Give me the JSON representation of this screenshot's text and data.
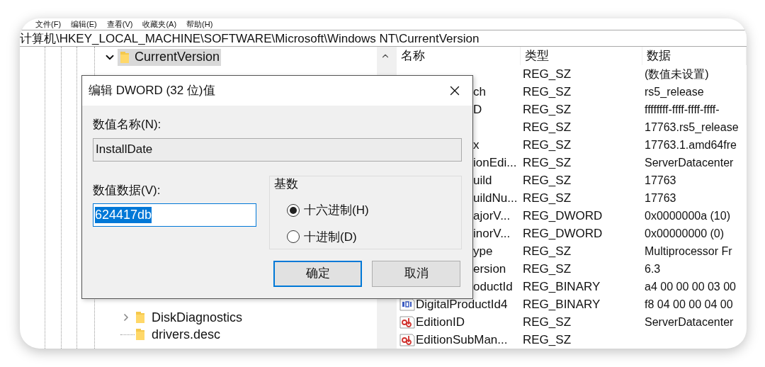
{
  "menu_bar": [
    "文件(F)",
    "编辑(E)",
    "查看(V)",
    "收藏夹(A)",
    "帮助(H)"
  ],
  "address_bar": "计算机\\HKEY_LOCAL_MACHINE\\SOFTWARE\\Microsoft\\Windows NT\\CurrentVersion",
  "tree": [
    {
      "label": "CurrentVersion",
      "expanded": true,
      "selected": true,
      "children": [
        {
          "label": "DiskDiagnostics",
          "kind": "folder"
        },
        {
          "label": "drivers.desc",
          "kind": "leaf"
        }
      ]
    }
  ],
  "list": {
    "columns": [
      "名称",
      "类型",
      "数据"
    ],
    "rows": [
      {
        "type": "REG_SZ",
        "data": "(数值未设置)"
      },
      {
        "name": "ch",
        "type": "REG_SZ",
        "data": "rs5_release",
        "partial": true
      },
      {
        "name": "D",
        "type": "REG_SZ",
        "data": "ffffffff-ffff-ffff-ffff-",
        "partial": true
      },
      {
        "type": "REG_SZ",
        "data": "17763.rs5_release"
      },
      {
        "name": "x",
        "type": "REG_SZ",
        "data": "17763.1.amd64fre",
        "partial": true
      },
      {
        "name": "ionEdi...",
        "type": "REG_SZ",
        "data": "ServerDatacenter",
        "partial": true
      },
      {
        "name": "uild",
        "type": "REG_SZ",
        "data": "17763",
        "partial": true
      },
      {
        "name": "uildNu...",
        "type": "REG_SZ",
        "data": "17763",
        "partial": true
      },
      {
        "name": "ajorV...",
        "type": "REG_DWORD",
        "data": "0x0000000a (10)",
        "partial": true
      },
      {
        "name": "inorV...",
        "type": "REG_DWORD",
        "data": "0x00000000 (0)",
        "partial": true
      },
      {
        "name": "ype",
        "type": "REG_SZ",
        "data": "Multiprocessor Fr",
        "partial": true
      },
      {
        "name": "ersion",
        "type": "REG_SZ",
        "data": "6.3",
        "partial": true
      },
      {
        "name": "oductId",
        "type": "REG_BINARY",
        "data": "a4 00 00 00 03 00",
        "partial": true
      },
      {
        "name": "DigitalProductId4",
        "type": "REG_BINARY",
        "data": "f8 04 00 00 04 00",
        "partial": false,
        "kind": "binary"
      },
      {
        "name": "EditionID",
        "type": "REG_SZ",
        "data": "ServerDatacenter",
        "partial": false,
        "kind": "string"
      },
      {
        "name": "EditionSubMan...",
        "type": "REG_SZ",
        "partial": false,
        "kind": "string"
      }
    ]
  },
  "dialog": {
    "title": "编辑 DWORD (32 位)值",
    "name_label": "数值名称(N):",
    "name_value": "InstallDate",
    "data_label": "数值数据(V):",
    "data_value": "624417db",
    "base": {
      "title": "基数",
      "options": [
        {
          "label": "十六进制(H)",
          "selected": true
        },
        {
          "label": "十进制(D)",
          "selected": false
        }
      ]
    },
    "buttons": [
      {
        "label": "确定",
        "focused": true
      },
      {
        "label": "取消",
        "focused": false
      }
    ]
  }
}
